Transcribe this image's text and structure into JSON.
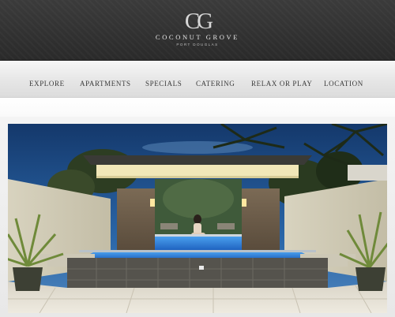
{
  "brand": {
    "name": "COCONUT GROVE",
    "location": "PORT DOUGLAS",
    "logo_mark": "CG"
  },
  "nav": {
    "items": [
      {
        "label": "EXPLORE"
      },
      {
        "label": "APARTMENTS"
      },
      {
        "label": "SPECIALS"
      },
      {
        "label": "CATERING"
      },
      {
        "label": "RELAX OR PLAY"
      },
      {
        "label": "LOCATION"
      }
    ]
  },
  "hero": {
    "image": "pool-cabana-photo"
  },
  "colors": {
    "header_bg": "#2f2f2f",
    "nav_bg": "#e8e8e8",
    "nav_text": "#3a3a3a",
    "sky": "#1f4f8c",
    "pool": "#2f7fd6"
  }
}
